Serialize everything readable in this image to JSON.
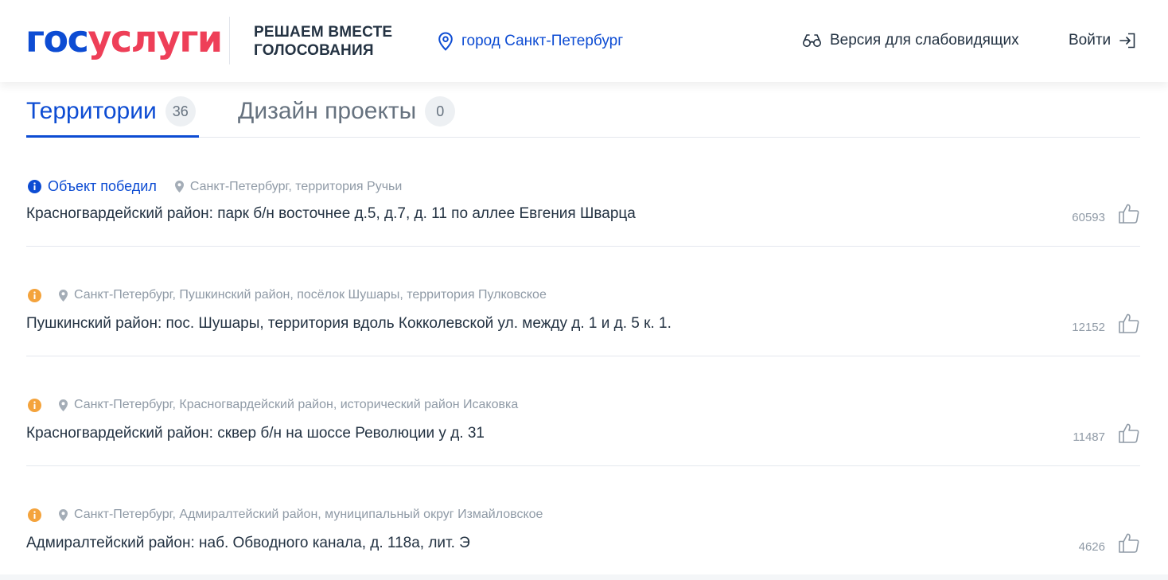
{
  "header": {
    "logo": {
      "part1": "гос",
      "part2": "услуги"
    },
    "slogan": {
      "line1": "РЕШАЕМ ВМЕСТЕ",
      "line2": "ГОЛОСОВАНИЯ"
    },
    "city": "город Санкт-Петербург",
    "accessibility": "Версия для слабовидящих",
    "login": "Войти"
  },
  "tabs": [
    {
      "label": "Территории",
      "count": "36",
      "active": true
    },
    {
      "label": "Дизайн проекты",
      "count": "0",
      "active": false
    }
  ],
  "items": [
    {
      "status": "winner",
      "status_label": "Объект победил",
      "location": "Санкт-Петербург, территория Ручьи",
      "title": "Красногвардейский район: парк б/н восточнее д.5, д.7, д. 11 по аллее Евгения Шварца",
      "votes": "60593"
    },
    {
      "status": "info",
      "status_label": "",
      "location": "Санкт-Петербург, Пушкинский район, посёлок Шушары, территория Пулковское",
      "title": "Пушкинский район: пос. Шушары, территория вдоль Кокколевской ул. между д. 1 и д. 5 к. 1.",
      "votes": "12152"
    },
    {
      "status": "info",
      "status_label": "",
      "location": "Санкт-Петербург, Красногвардейский район, исторический район Исаковка",
      "title": "Красногвардейский район: сквер б/н на шоссе Революции у д. 31",
      "votes": "11487"
    },
    {
      "status": "info",
      "status_label": "",
      "location": "Санкт-Петербург, Адмиралтейский район, муниципальный округ Измайловское",
      "title": "Адмиралтейский район: наб. Обводного канала, д. 118а, лит. Э",
      "votes": "4626"
    }
  ],
  "colors": {
    "brand_blue": "#0d4cd3",
    "brand_red": "#ee3f58",
    "info_orange": "#f4a33c",
    "text": "#233242",
    "muted": "#8f9aa6"
  },
  "icons": {
    "city": "location-pin-icon",
    "accessibility": "glasses-icon",
    "login": "login-arrow-icon",
    "winner": "info-circle-blue-icon",
    "info": "info-circle-orange-icon",
    "location": "map-pin-icon",
    "like": "thumbs-up-icon"
  }
}
